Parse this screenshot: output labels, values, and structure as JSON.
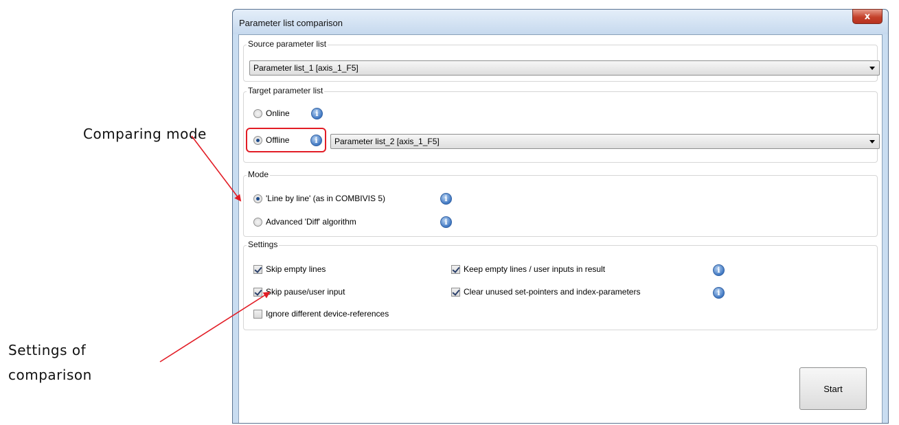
{
  "annotations": {
    "comparing_mode": "Comparing mode",
    "settings_line1": "Settings of",
    "settings_line2": "comparison"
  },
  "dialog": {
    "title": "Parameter list comparison",
    "close_label": "x"
  },
  "source_group": {
    "label": "Source parameter list",
    "selected": "Parameter list_1 [axis_1_F5]"
  },
  "target_group": {
    "label": "Target parameter list",
    "online_label": "Online",
    "offline_label": "Offline",
    "offline_selected": "Parameter list_2 [axis_1_F5]",
    "online_checked": false,
    "offline_checked": true
  },
  "mode_group": {
    "label": "Mode",
    "line_by_line": "'Line by line' (as in COMBIVIS 5)",
    "advanced_diff": "Advanced 'Diff' algorithm"
  },
  "settings_group": {
    "label": "Settings",
    "skip_empty_lines": "Skip empty lines",
    "skip_pause": "Skip pause/user input",
    "ignore_device_refs": "Ignore different device-references",
    "keep_empty_lines": "Keep empty lines / user inputs in result",
    "clear_unused": "Clear unused set-pointers and index-parameters"
  },
  "info_glyph": "i",
  "start_label": "Start",
  "colors": {
    "highlight": "#e21c25",
    "title_bar": "#c9ddf1"
  },
  "icons": [
    "info-icon",
    "close-icon",
    "chevron-down-icon"
  ]
}
